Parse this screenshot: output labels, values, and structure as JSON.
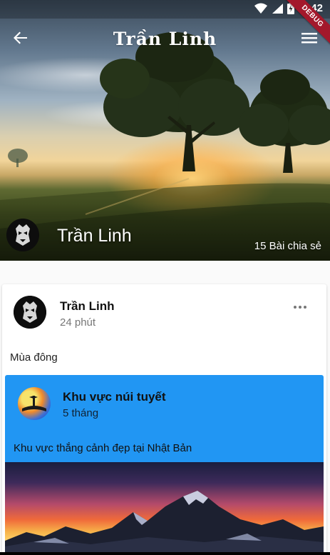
{
  "status_bar": {
    "time": "7:42",
    "icons": [
      "wifi-icon",
      "cell-signal-icon",
      "battery-icon"
    ]
  },
  "debug_banner": "DEBUG",
  "app_bar": {
    "title": "Trần Linh",
    "back_icon": "arrow-left-icon",
    "menu_icon": "hamburger-menu-icon"
  },
  "profile": {
    "name": "Trần Linh",
    "share_count": "15 Bài chia sẻ"
  },
  "post": {
    "author": "Trần Linh",
    "time": "24 phút",
    "text": "Mùa đông",
    "more_icon": "more-horizontal-icon",
    "shared": {
      "title": "Khu vực núi tuyết",
      "time": "5 tháng",
      "text": "Khu vực thắng cảnh đẹp tại Nhật Bản"
    }
  },
  "colors": {
    "shared_card_bg": "#2196f3",
    "debug_ribbon": "#a3182b"
  }
}
